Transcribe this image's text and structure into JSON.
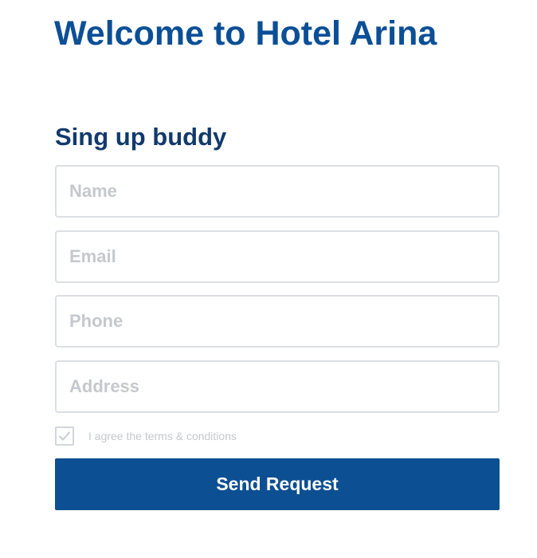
{
  "header": {
    "title": "Welcome to Hotel Arina"
  },
  "signup_form": {
    "heading": "Sing up buddy",
    "fields": [
      {
        "placeholder": "Name",
        "value": ""
      },
      {
        "placeholder": "Email",
        "value": ""
      },
      {
        "placeholder": "Phone",
        "value": ""
      },
      {
        "placeholder": "Address",
        "value": ""
      }
    ],
    "terms": {
      "label": "I agree the terms & conditions",
      "checked": true
    },
    "submit_label": "Send Request"
  },
  "colors": {
    "title": "#0b4f96",
    "heading": "#123a6b",
    "button": "#0c4f92",
    "field_border": "#dcdfe3",
    "placeholder": "#c5c8cc"
  },
  "icons": {
    "checkbox_mark": "checkmark-icon"
  }
}
